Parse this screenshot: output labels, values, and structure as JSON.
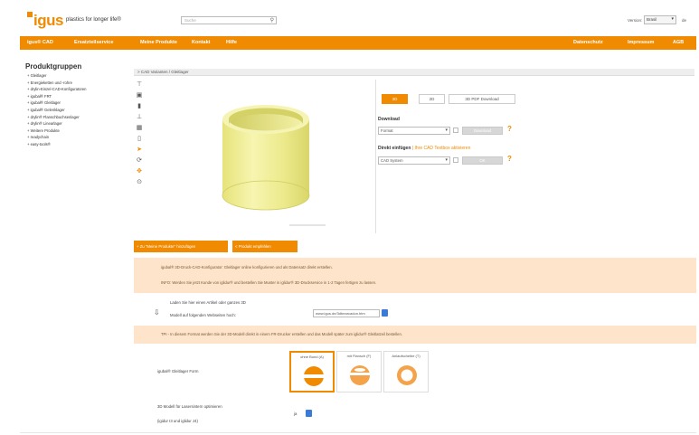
{
  "header": {
    "logo": "igus",
    "tagline": "plastics for longer life®",
    "search_placeholder": "Suche",
    "country_label": "Version:",
    "country_value": "Brasil",
    "language": "de"
  },
  "nav": {
    "items": [
      "igus® CAD",
      "Ersatzteilservice",
      "Meine Produkte",
      "Kontakt",
      "Hilfe"
    ],
    "right_items": [
      "Datenschutz",
      "Impressum",
      "AGB"
    ]
  },
  "sidebar": {
    "title": "Produktgruppen",
    "items": [
      "+ Gleitlager",
      "+ Energieketten und -rohre",
      "+ drylin-Einzel-CAD-Konfiguratoren",
      "+ igubal® FRT",
      "+ igubal® Gleitlager",
      "+ igubal® Gelenklager",
      "+ drylin® Flanschbuchsenlager",
      "+ drylin® Linearlager",
      "+ Weitere Produkte",
      "+ readychain",
      "+ easy-tools®"
    ]
  },
  "breadcrumb": "> CAD Varianten / Gleitlager",
  "view_modes": [
    "3D",
    "2D",
    "3D PDF Download"
  ],
  "download": {
    "label": "Download",
    "format_value": "Format",
    "button_label": "Download"
  },
  "insert": {
    "label": "Direkt einfügen",
    "link": "| Ihre CAD Textbox aktivieren",
    "cad_value": "CAD System",
    "button_label": "OK"
  },
  "actions": {
    "add_to_products": "+ Zu \"Meine Produkte\" hinzufügen",
    "share": "Produkt empfehlen"
  },
  "info": {
    "text1": "igubal® 3D-Druck-CAD-Konfigurator: Gleitlager online konfigurieren und als Datensatz direkt erstellen.",
    "text2": "INFO: Werden Sie jetzt Kunde von iglidur® und bestellen Sie Muster in iglidur® 3D-Druckservice in 1-2 Tagen fertigen zu lassen.",
    "hint": "TPI - In diesem Format werden Sie der 3D-Modell direkt in einem FR-Drucker erstellen und das Modell später zum iglidur® Gleitlatzeil bestellen."
  },
  "share_row": {
    "line1": "Laden Sie hier einen Artikel oder ganzes 3D",
    "line2": "Modell auf folgenden Webseiten hoch:",
    "url": "www.igus.de/3dbearcadon.htm"
  },
  "variants": {
    "label": "igubal® Gleitlager Form",
    "options": [
      "ohne Bund (A)",
      "mit Flansch (F)",
      "Anlaufscheibe (T)"
    ],
    "selected_index": 0
  },
  "print_row": {
    "line1": "3D Modell für Lasersintern optimieren",
    "line2": "(igidur I3 und iglidur J4)",
    "value": "ja"
  },
  "colors": {
    "accent": "#f08a00",
    "info_band": "#fde4cb",
    "part_fill": "#f2f09a",
    "link_blue": "#3a7ad8"
  }
}
